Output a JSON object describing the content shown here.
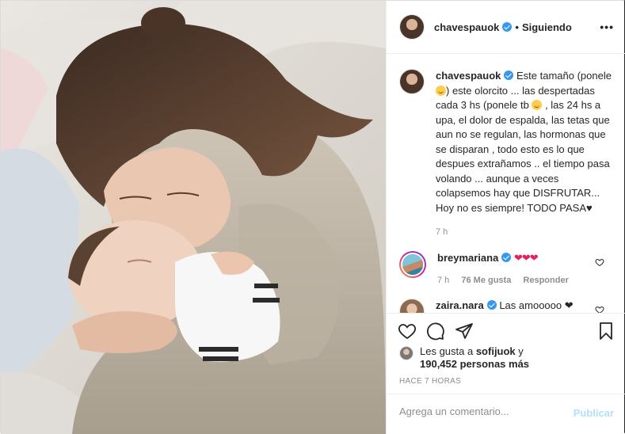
{
  "post": {
    "username": "chavespauok",
    "follow_separator": "•",
    "follow_status": "Siguiendo",
    "more_label": "•••",
    "caption": {
      "username": "chavespauok",
      "text_1": "Este tamaño (ponele",
      "text_2": ") este olorcito ... las despertadas cada 3 hs (ponele tb",
      "text_3": ", las 24 hs a upa, el dolor de espalda, las tetas que aun no se regulan, las hormonas que se disparan , todo esto es lo que despues extrañamos .. el tiempo pasa volando ... aunque a veces colapsemos hay que DISFRUTAR... Hoy no es siempre! TODO PASA♥",
      "time": "7 h"
    },
    "comments": [
      {
        "username": "breymariana",
        "text": "❤❤❤",
        "time": "7 h",
        "likes": "76 Me gusta",
        "reply": "Responder"
      },
      {
        "username": "zaira.nara",
        "text": "Las amooooo ❤"
      }
    ],
    "likes_line_1": "Les gusta a ",
    "likes_user": "sofijuok",
    "likes_line_1_end": " y",
    "likes_count": "190,452 personas más",
    "timestamp": "HACE 7 HORAS",
    "comment_placeholder": "Agrega un comentario...",
    "publish_label": "Publicar"
  },
  "colors": {
    "accent": "#3897f0",
    "heart": "#e0245e",
    "publish_disabled": "#b2dffc",
    "muted": "#8e8e8e"
  },
  "icons": [
    "verified-badge-icon",
    "more-options-icon",
    "heart-icon",
    "comment-icon",
    "share-icon",
    "bookmark-icon"
  ]
}
